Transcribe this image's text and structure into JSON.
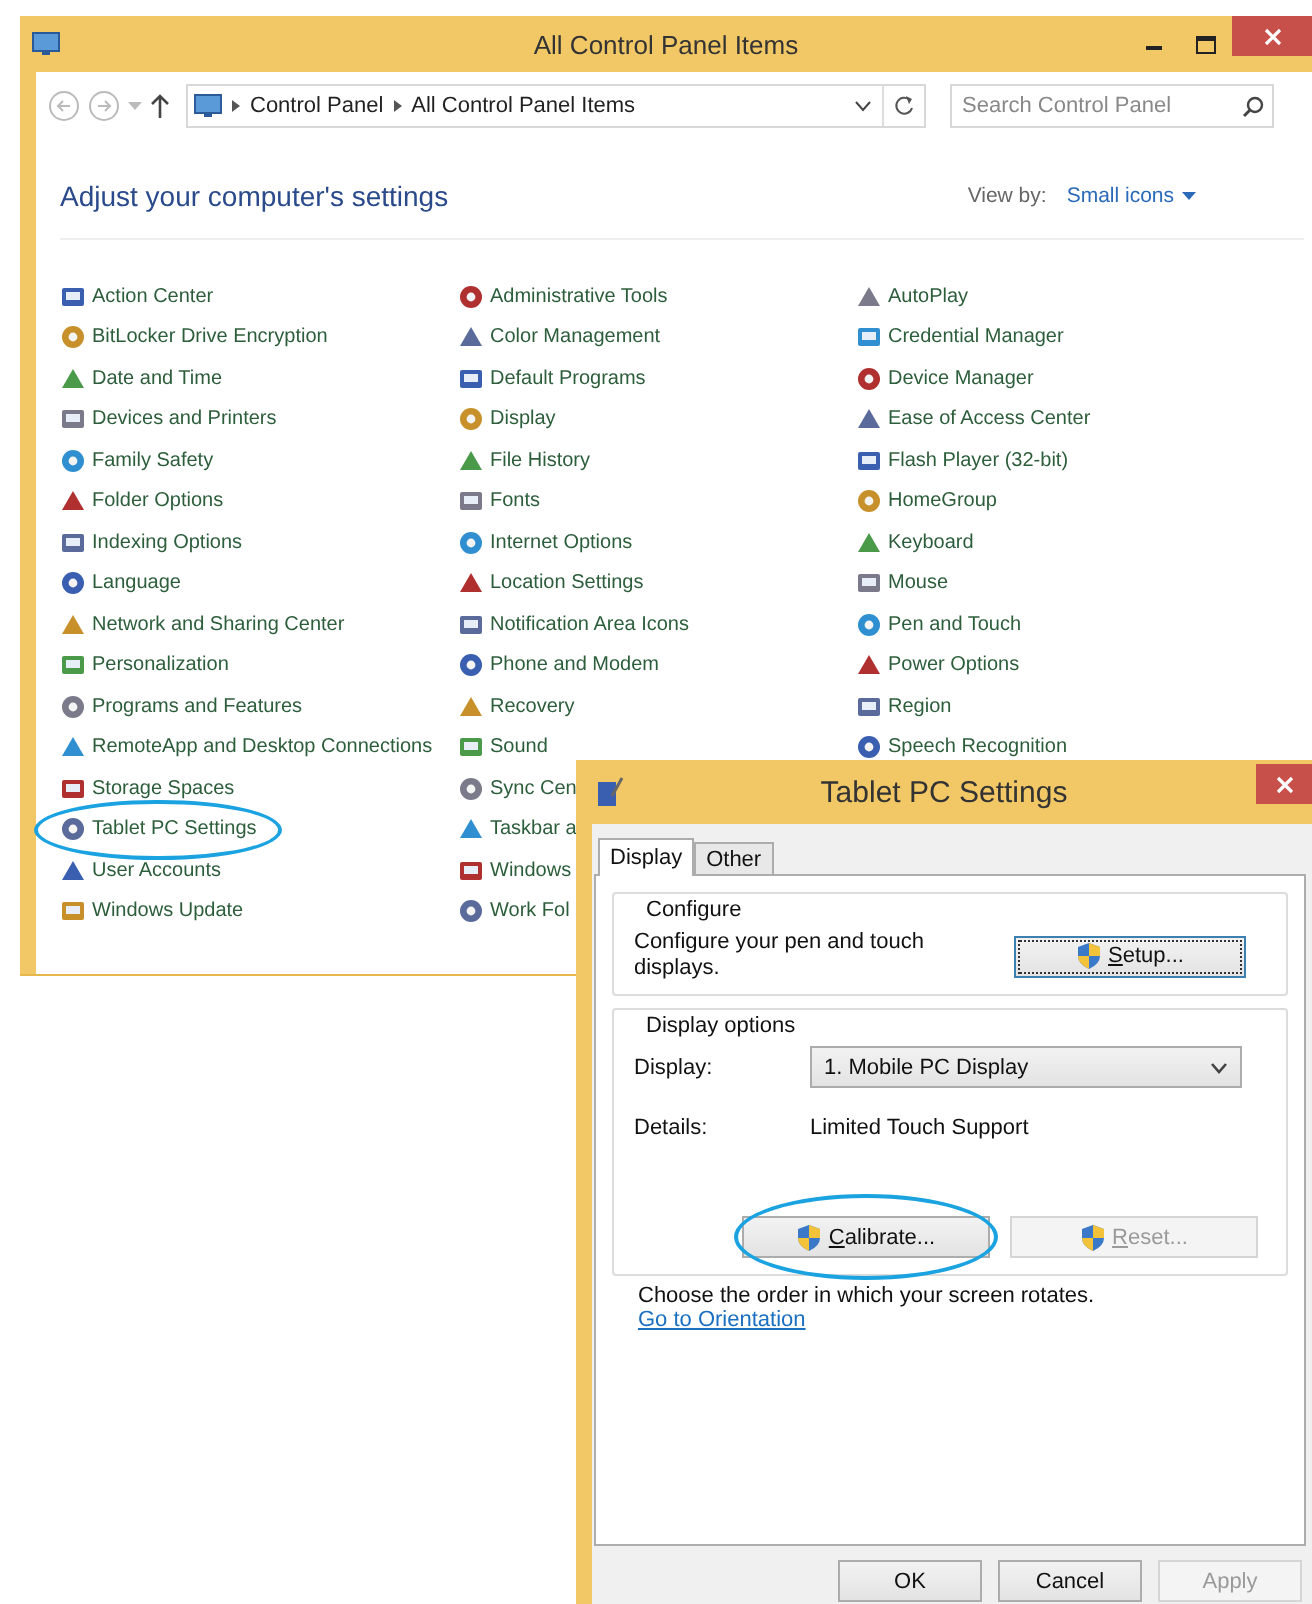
{
  "window": {
    "title": "All Control Panel Items"
  },
  "address_bar": {
    "path": [
      "Control Panel",
      "All Control Panel Items"
    ]
  },
  "search": {
    "placeholder": "Search Control Panel"
  },
  "heading": "Adjust your computer's settings",
  "view_by": {
    "label": "View by:",
    "value": "Small icons"
  },
  "columns": [
    {
      "items": [
        {
          "label": "Action Center",
          "circled": false
        },
        {
          "label": "BitLocker Drive Encryption",
          "circled": false
        },
        {
          "label": "Date and Time",
          "circled": false
        },
        {
          "label": "Devices and Printers",
          "circled": false
        },
        {
          "label": "Family Safety",
          "circled": false
        },
        {
          "label": "Folder Options",
          "circled": false
        },
        {
          "label": "Indexing Options",
          "circled": false
        },
        {
          "label": "Language",
          "circled": false
        },
        {
          "label": "Network and Sharing Center",
          "circled": false
        },
        {
          "label": "Personalization",
          "circled": false
        },
        {
          "label": "Programs and Features",
          "circled": false
        },
        {
          "label": "RemoteApp and Desktop Connections",
          "circled": false
        },
        {
          "label": "Storage Spaces",
          "circled": false
        },
        {
          "label": "Tablet PC Settings",
          "circled": true
        },
        {
          "label": "User Accounts",
          "circled": false
        },
        {
          "label": "Windows Update",
          "circled": false
        }
      ]
    },
    {
      "items": [
        {
          "label": "Administrative Tools",
          "circled": false
        },
        {
          "label": "Color Management",
          "circled": false
        },
        {
          "label": "Default Programs",
          "circled": false
        },
        {
          "label": "Display",
          "circled": false
        },
        {
          "label": "File History",
          "circled": false
        },
        {
          "label": "Fonts",
          "circled": false
        },
        {
          "label": "Internet Options",
          "circled": false
        },
        {
          "label": "Location Settings",
          "circled": false
        },
        {
          "label": "Notification Area Icons",
          "circled": false
        },
        {
          "label": "Phone and Modem",
          "circled": false
        },
        {
          "label": "Recovery",
          "circled": false
        },
        {
          "label": "Sound",
          "circled": false
        },
        {
          "label": "Sync Cen",
          "circled": false
        },
        {
          "label": "Taskbar a",
          "circled": false
        },
        {
          "label": "Windows",
          "circled": false
        },
        {
          "label": "Work Fol",
          "circled": false
        }
      ]
    },
    {
      "items": [
        {
          "label": "AutoPlay",
          "circled": false
        },
        {
          "label": "Credential Manager",
          "circled": false
        },
        {
          "label": "Device Manager",
          "circled": false
        },
        {
          "label": "Ease of Access Center",
          "circled": false
        },
        {
          "label": "Flash Player (32-bit)",
          "circled": false
        },
        {
          "label": "HomeGroup",
          "circled": false
        },
        {
          "label": "Keyboard",
          "circled": false
        },
        {
          "label": "Mouse",
          "circled": false
        },
        {
          "label": "Pen and Touch",
          "circled": false
        },
        {
          "label": "Power Options",
          "circled": false
        },
        {
          "label": "Region",
          "circled": false
        },
        {
          "label": "Speech Recognition",
          "circled": false
        }
      ]
    }
  ],
  "dialog": {
    "title": "Tablet PC Settings",
    "tabs": [
      {
        "label": "Display",
        "selected": true
      },
      {
        "label": "Other",
        "selected": false
      }
    ],
    "configure": {
      "title": "Configure",
      "text": "Configure your pen and touch displays.",
      "button": {
        "label": "Setup...",
        "focused": true,
        "disabled": false,
        "circled": false
      }
    },
    "display_options": {
      "title": "Display options",
      "display_label": "Display:",
      "display_value": "1. Mobile PC Display",
      "details_label": "Details:",
      "details_value": "Limited Touch Support",
      "buttons": [
        {
          "label": "Calibrate...",
          "focused": false,
          "disabled": false,
          "circled": true
        },
        {
          "label": "Reset...",
          "focused": false,
          "disabled": true,
          "circled": false
        }
      ]
    },
    "orientation_text": "Choose the order in which your screen rotates.",
    "orientation_link": "Go to Orientation",
    "buttons": [
      {
        "label": "OK",
        "disabled": false
      },
      {
        "label": "Cancel",
        "disabled": false
      },
      {
        "label": "Apply",
        "disabled": true
      }
    ]
  }
}
